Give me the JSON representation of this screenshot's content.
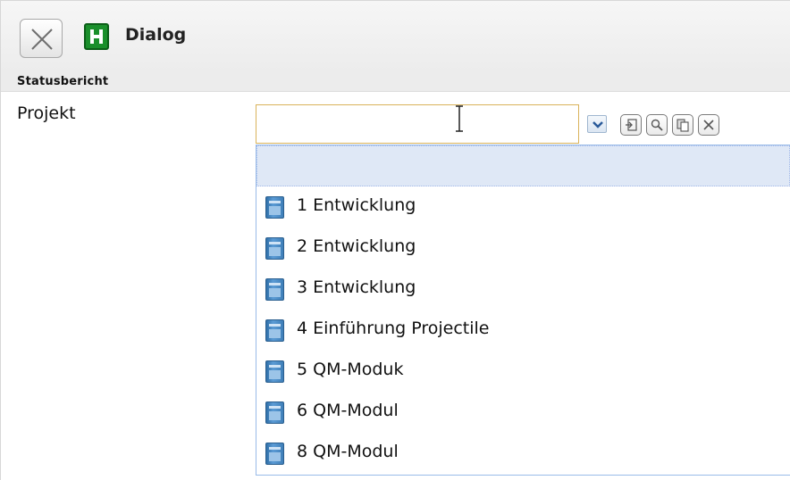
{
  "window": {
    "title": "Dialog"
  },
  "icons": {
    "close": "close-icon",
    "app": "app-logo-icon",
    "dropdown": "chevron-down-icon",
    "tool1": "open-icon",
    "tool2": "search-icon",
    "tool3": "copy-icon",
    "tool4": "clear-icon",
    "item": "project-icon"
  },
  "section": {
    "title": "Statusbericht"
  },
  "form": {
    "projekt_label": "Projekt",
    "projekt_value": ""
  },
  "dropdown": {
    "items": [
      {
        "label": ""
      },
      {
        "label": "1 Entwicklung"
      },
      {
        "label": "2 Entwicklung"
      },
      {
        "label": "3 Entwicklung"
      },
      {
        "label": "4 Einführung Projectile"
      },
      {
        "label": "5 QM-Moduk"
      },
      {
        "label": "6 QM-Modul"
      },
      {
        "label": "8 QM-Modul"
      }
    ]
  },
  "colors": {
    "input_border_focus": "#d9b25a",
    "list_border": "#99bbe8",
    "list_highlight": "#dfe8f6",
    "app_icon": "#1a8f2b"
  }
}
